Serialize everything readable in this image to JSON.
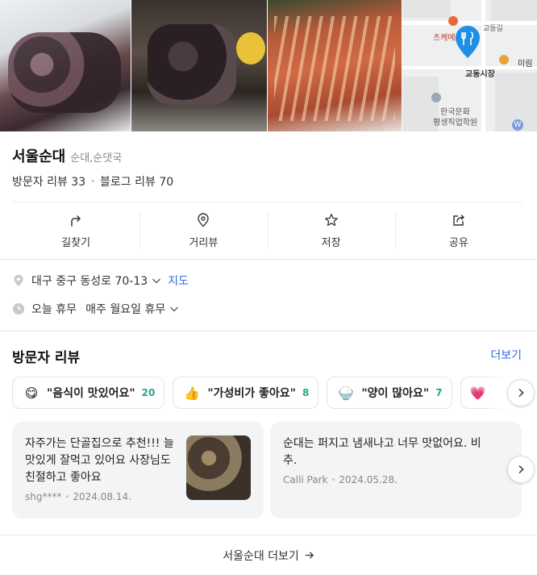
{
  "map": {
    "labels": {
      "top_road": "교동길",
      "poi_left": "츠케메",
      "poi_right": "미림",
      "market": "교동시장",
      "institute_1": "한국문화",
      "institute_2": "평생직업학원",
      "badge": "W"
    }
  },
  "place": {
    "name": "서울순대",
    "category": "순대,순댓국",
    "visitor_reviews": "방문자 리뷰 33",
    "blog_reviews": "블로그 리뷰 70"
  },
  "actions": [
    {
      "label": "길찾기",
      "icon": "directions-icon"
    },
    {
      "label": "거리뷰",
      "icon": "street-view-icon"
    },
    {
      "label": "저장",
      "icon": "star-icon"
    },
    {
      "label": "공유",
      "icon": "share-icon"
    }
  ],
  "info": {
    "address": "대구 중구 동성로 70-13",
    "map_link": "지도",
    "hours_today": "오늘 휴무",
    "hours_note": "매주 월요일 휴무"
  },
  "reviews_section": {
    "title": "방문자 리뷰",
    "more": "더보기",
    "keywords": [
      {
        "emoji": "😋",
        "text": "\"음식이 맛있어요\"",
        "count": "20"
      },
      {
        "emoji": "👍",
        "text": "\"가성비가 좋아요\"",
        "count": "8"
      },
      {
        "emoji": "🍚",
        "text": "\"양이 많아요\"",
        "count": "7"
      }
    ],
    "cards": [
      {
        "text": "자주가는 단골집으로 추천!!! 늘맛있게 잘먹고 있어요 사장님도 친절하고 좋아요",
        "author": "shg****",
        "date": "2024.08.14."
      },
      {
        "text": "순대는 퍼지고 냄새나고 너무 맛없어요. 비추.",
        "author": "Calli Park",
        "date": "2024.05.28."
      }
    ]
  },
  "footer": {
    "more_link": "서울순대 더보기"
  },
  "colors": {
    "accent": "#2f6ce0",
    "count_green": "#2aa38b",
    "card_bg": "#f3f4f6"
  }
}
